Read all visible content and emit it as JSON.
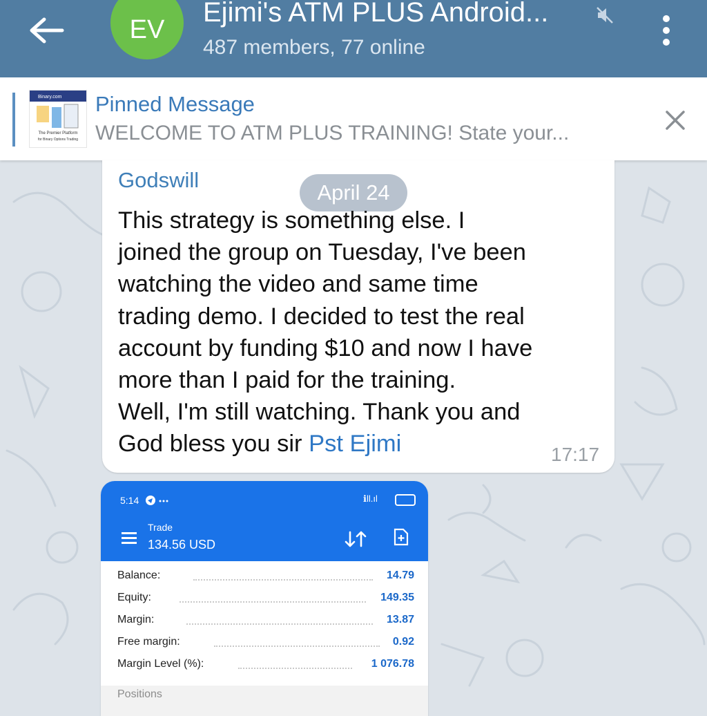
{
  "header": {
    "back_icon": "arrow-left-icon",
    "avatar_initials": "EV",
    "avatar_color": "#6cc04a",
    "title": "Ejimi's ATM PLUS Android...",
    "mute_icon": "muted-speaker-icon",
    "subtitle": "487 members, 77 online",
    "menu_icon": "more-vertical-icon",
    "color": "#517da2"
  },
  "pinned": {
    "title": "Pinned Message",
    "text": "WELCOME TO ATM PLUS TRAINING!  State your...",
    "thumbnail": {
      "brand": "Binary.com",
      "caption_line1": "The Premier Platform",
      "caption_line2": "for Binary Options Trading"
    },
    "close_icon": "close-icon"
  },
  "chat": {
    "date_label": "April 24",
    "message": {
      "sender": "Godswill",
      "lines": [
        "This strategy is something else. I",
        "joined the group on Tuesday, I've been",
        "watching the video and same time",
        "trading demo. I decided to test the real",
        "account by funding $10 and now I have",
        "more than I paid for the training.",
        "Well, I'm still watching. Thank you and"
      ],
      "last_line_prefix": "God bless you sir ",
      "mention": "Pst Ejimi",
      "time": "17:17"
    }
  },
  "screenshot": {
    "status_time": "5:14",
    "status_signal": "ℹll.ıl",
    "title": "Trade",
    "amount": "134.56 USD",
    "accent": "#1a73e8",
    "rows": [
      {
        "label": "Balance:",
        "value": "14.79"
      },
      {
        "label": "Equity:",
        "value": "149.35"
      },
      {
        "label": "Margin:",
        "value": "13.87"
      },
      {
        "label": "Free margin:",
        "value": "0.92"
      },
      {
        "label": "Margin Level (%):",
        "value": "1 076.78"
      }
    ],
    "positions_label": "Positions"
  }
}
